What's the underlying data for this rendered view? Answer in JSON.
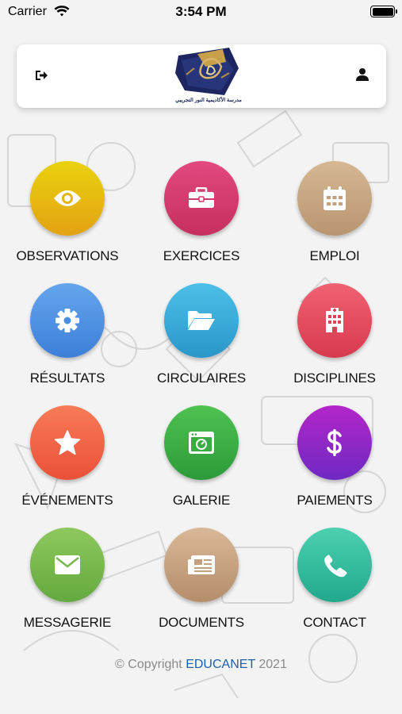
{
  "status_bar": {
    "carrier": "Carrier",
    "time": "3:54 PM"
  },
  "header": {
    "logo_text": "مدرسة الأكاديمية النور التجريبي",
    "logout_icon": "logout-icon",
    "user_icon": "user-icon"
  },
  "tiles": [
    {
      "label": "OBSERVATIONS",
      "icon": "eye-icon",
      "color_top": "#e9d20e",
      "color_bottom": "#e3a213"
    },
    {
      "label": "EXERCICES",
      "icon": "briefcase-icon",
      "color_top": "#e2497f",
      "color_bottom": "#c5305f"
    },
    {
      "label": "EMPLOI",
      "icon": "calendar-icon",
      "color_top": "#d6b893",
      "color_bottom": "#b89570"
    },
    {
      "label": "RÉSULTATS",
      "icon": "gear-icon",
      "color_top": "#63a6ec",
      "color_bottom": "#3d7fd8"
    },
    {
      "label": "CIRCULAIRES",
      "icon": "folder-open-icon",
      "color_top": "#4cc0e8",
      "color_bottom": "#2a96c9"
    },
    {
      "label": "DISCIPLINES",
      "icon": "building-icon",
      "color_top": "#f06273",
      "color_bottom": "#d73a4e"
    },
    {
      "label": "ÉVÉNEMENTS",
      "icon": "star-icon",
      "color_top": "#f77b57",
      "color_bottom": "#ea5038"
    },
    {
      "label": "GALERIE",
      "icon": "image-window-icon",
      "color_top": "#4fc251",
      "color_bottom": "#2c9a3a"
    },
    {
      "label": "PAIEMENTS",
      "icon": "dollar-icon",
      "color_top": "#b426c8",
      "color_bottom": "#6e29c3"
    },
    {
      "label": "MESSAGERIE",
      "icon": "envelope-icon",
      "color_top": "#8ec85e",
      "color_bottom": "#63a93f"
    },
    {
      "label": "DOCUMENTS",
      "icon": "document-list-icon",
      "color_top": "#d9b897",
      "color_bottom": "#b58d6a"
    },
    {
      "label": "CONTACT",
      "icon": "phone-icon",
      "color_top": "#4cd0b0",
      "color_bottom": "#22a88c"
    }
  ],
  "footer": {
    "prefix": "© Copyright",
    "brand": "EDUCANET",
    "year": "2021"
  }
}
